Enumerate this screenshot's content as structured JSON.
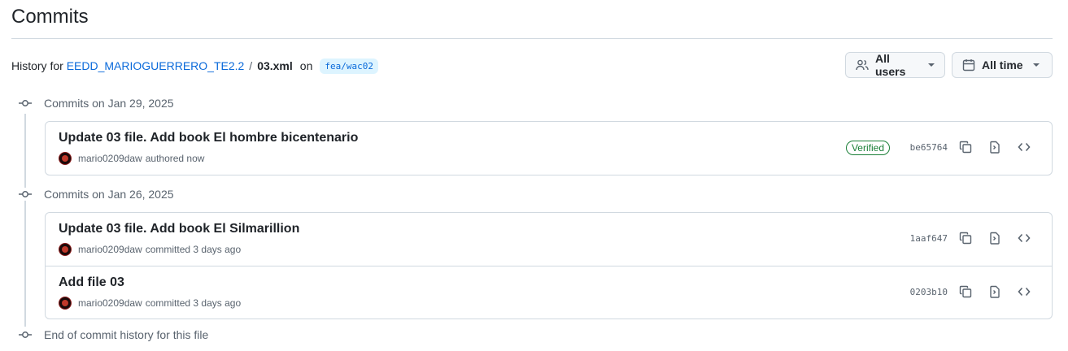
{
  "page": {
    "title": "Commits"
  },
  "history": {
    "prefix": "History for",
    "repo": "EEDD_MARIOGUERRERO_TE2.2",
    "separator": "/",
    "file": "03.xml",
    "on": "on",
    "branch": "fea/wac02"
  },
  "filters": {
    "users_label": "All users",
    "time_label": "All time"
  },
  "groups": [
    {
      "header": "Commits on Jan 29, 2025",
      "commits": [
        {
          "title": "Update 03 file. Add book El hombre bicentenario",
          "author": "mario0209daw",
          "action": "authored now",
          "verified": "Verified",
          "sha": "be65764"
        }
      ]
    },
    {
      "header": "Commits on Jan 26, 2025",
      "commits": [
        {
          "title": "Update 03 file. Add book El Silmarillion",
          "author": "mario0209daw",
          "action": "committed 3 days ago",
          "sha": "1aaf647"
        },
        {
          "title": "Add file 03",
          "author": "mario0209daw",
          "action": "committed 3 days ago",
          "sha": "0203b10"
        }
      ]
    }
  ],
  "footer": {
    "end_text": "End of commit history for this file"
  },
  "colors": {
    "link": "#0969da",
    "verified": "#1a7f37",
    "border": "#d1d9e0",
    "muted": "#59636e"
  }
}
